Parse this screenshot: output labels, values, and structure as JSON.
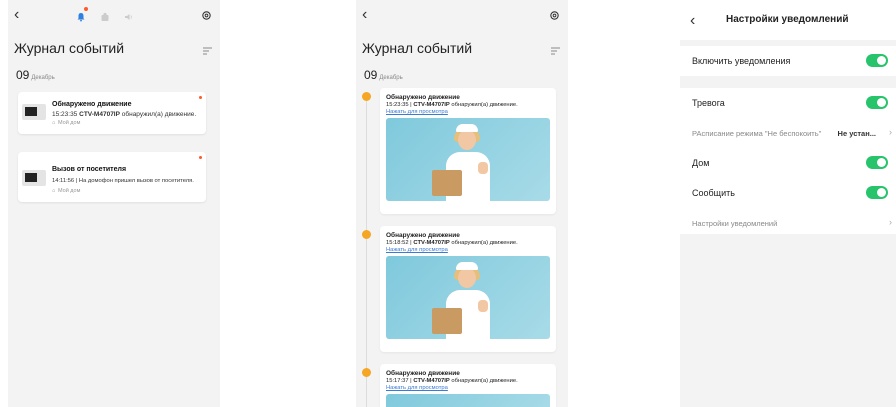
{
  "screen1": {
    "title": "Журнал событий",
    "date_day": "09",
    "date_month": "Декабрь",
    "events": [
      {
        "title": "Обнаружено движение",
        "time": "15:23:35",
        "device": "CTV-M4707IP",
        "text": "обнаружил(а) движение.",
        "location": "Мой дом"
      },
      {
        "title": "Вызов от посетителя",
        "time": "14:11:56",
        "device": "",
        "text": "| На домофон пришел вызов от посетителя.",
        "location": "Мой дом"
      }
    ]
  },
  "screen2": {
    "title": "Журнал событий",
    "date_day": "09",
    "date_month": "Декабрь",
    "events": [
      {
        "title": "Обнаружено движение",
        "time": "15:23:35 |",
        "device": "CTV-M4707IP",
        "text": "обнаружил(а) движение.",
        "link": "Нажать для просмотра"
      },
      {
        "title": "Обнаружено движение",
        "time": "15:18:52 |",
        "device": "CTV-M4707IP",
        "text": "обнаружил(а) движение.",
        "link": "Нажать для просмотра"
      },
      {
        "title": "Обнаружено движение",
        "time": "15:17:37 |",
        "device": "CTV-M4707IP",
        "text": "обнаружил(а) движение.",
        "link": "Нажать для просмотра"
      }
    ]
  },
  "screen3": {
    "title": "Настройки уведомлений",
    "rows": [
      {
        "label": "Включить уведомления",
        "toggle": true
      },
      {
        "label": "Тревога",
        "toggle": true
      },
      {
        "label": "РАсписание режима \"Не беспокоить\"",
        "value": "Не устан..."
      },
      {
        "label": "Дом",
        "toggle": true
      },
      {
        "label": "Сообщить",
        "toggle": true
      },
      {
        "label": "Настройки уведомлений"
      }
    ]
  },
  "colors": {
    "accent": "#27c46b",
    "alert": "#ff5a2a",
    "timeline": "#f5a623",
    "link": "#3a7bd5"
  }
}
